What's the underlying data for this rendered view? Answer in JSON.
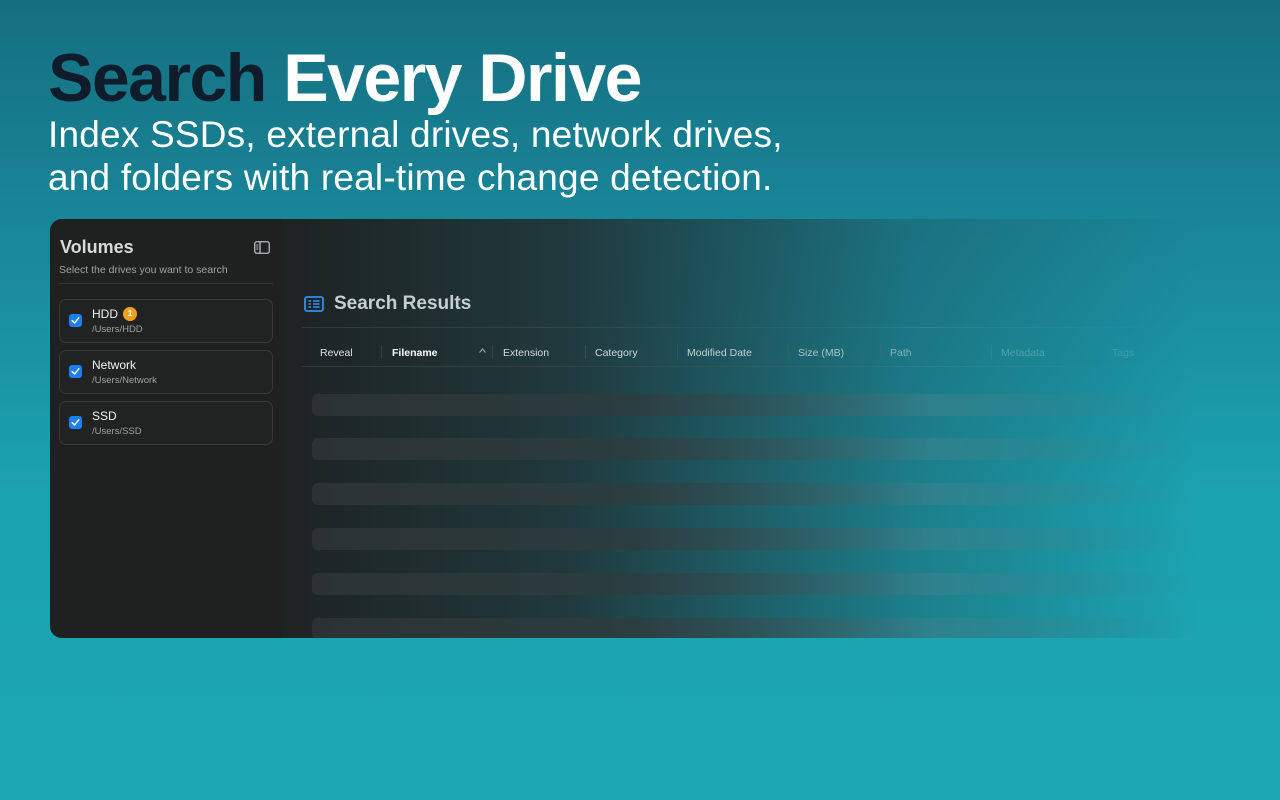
{
  "hero": {
    "title_dark": "Search",
    "title_light": "Every Drive",
    "subtitle_line1": "Index SSDs, external drives, network drives,",
    "subtitle_line2": "and folders with real-time change detection."
  },
  "sidebar": {
    "title": "Volumes",
    "subtitle": "Select the drives you want to search",
    "toggle_icon": "sidebar-toggle-icon",
    "volumes": [
      {
        "name": "HDD",
        "path": "/Users/HDD",
        "checked": true,
        "badge": "1"
      },
      {
        "name": "Network",
        "path": "/Users/Network",
        "checked": true
      },
      {
        "name": "SSD",
        "path": "/Users/SSD",
        "checked": true
      }
    ]
  },
  "results": {
    "icon": "list-icon",
    "title": "Search Results",
    "columns": [
      {
        "label": "Reveal"
      },
      {
        "label": "Filename",
        "sorted": "ascending"
      },
      {
        "label": "Extension"
      },
      {
        "label": "Category"
      },
      {
        "label": "Modified Date"
      },
      {
        "label": "Size (MB)"
      },
      {
        "label": "Path"
      },
      {
        "label": "Metadata"
      },
      {
        "label": "Tags"
      }
    ]
  },
  "colors": {
    "accent": "#1a7ff0",
    "badge": "#f0a11b",
    "background_top": "#146f80",
    "background_bottom": "#1ca6b3"
  }
}
